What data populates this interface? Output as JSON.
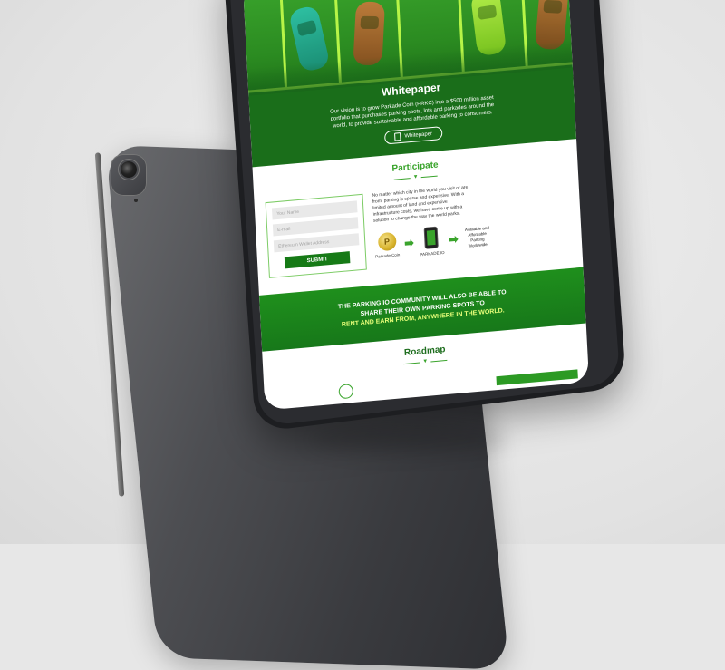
{
  "whitepaper": {
    "title": "Whitepaper",
    "text": "Our vision is to grow Parkade Coin (PRKC) into a $500 million asset portfolio that purchases parking spots, lots and parkades around the world, to provide sustainable and affordable parking to consumers.",
    "button_label": "Whitepaper"
  },
  "participate": {
    "title": "Participate",
    "form": {
      "name_placeholder": "Your Name",
      "email_placeholder": "E-mail",
      "wallet_placeholder": "Ethereum Wallet Address",
      "submit_label": "SUBMIT"
    },
    "description": "No matter which city in the world you visit or are from, parking is sparse and expensive. With a limited amount of land and expensive infrastructure costs, we have come up with a solution to change the way the world parks.",
    "flow": {
      "coin_label": "Parkade Coin",
      "app_label": "PARKADE.IO",
      "result_label": "Available and Affordable Parking Worldwide"
    }
  },
  "banner": {
    "line1": "THE PARKING.IO COMMUNITY WILL ALSO BE ABLE TO",
    "line2": "SHARE THEIR OWN PARKING SPOTS TO",
    "line3": "RENT AND EARN FROM, ANYWHERE IN THE WORLD."
  },
  "roadmap": {
    "title": "Roadmap"
  },
  "colors": {
    "brand_green": "#3aa42c",
    "dark_green": "#1a6e1a",
    "highlight_yellow": "#e9ff7a"
  }
}
